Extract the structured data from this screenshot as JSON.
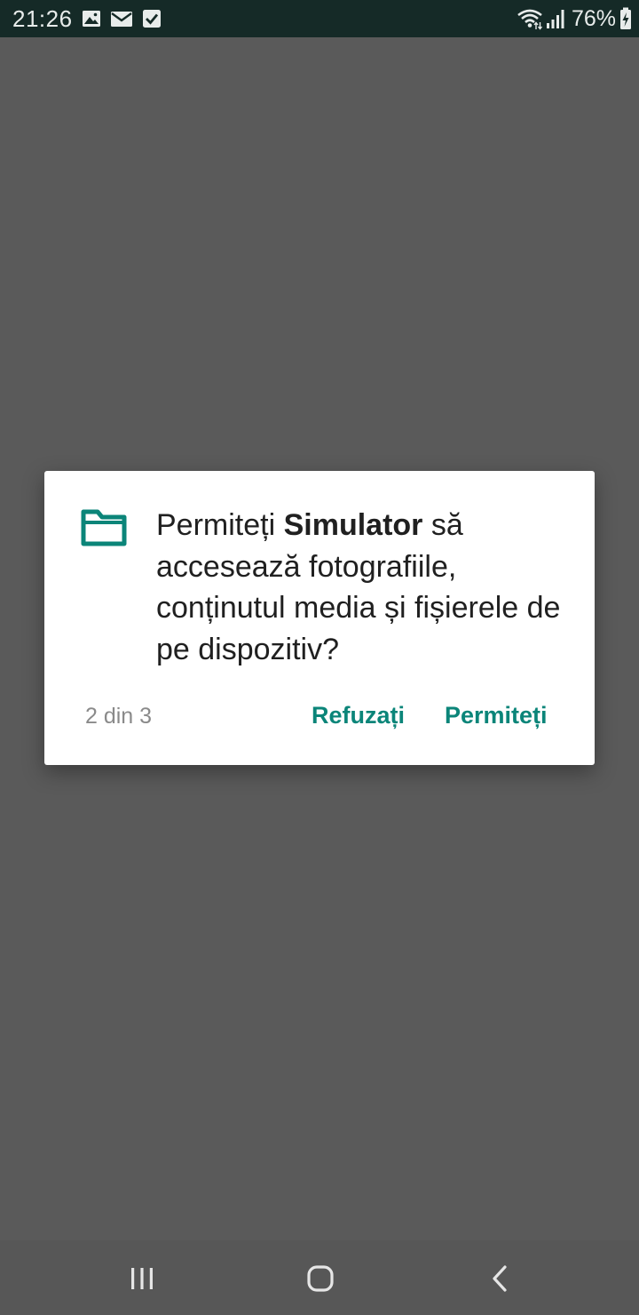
{
  "status_bar": {
    "time": "21:26",
    "left_icons": [
      "image-icon",
      "email-icon",
      "checkbox-icon"
    ],
    "right_icons": [
      "wifi-icon",
      "signal-icon",
      "battery-charging-icon"
    ],
    "battery_percent": "76%"
  },
  "dialog": {
    "icon": "folder-icon",
    "message_prefix": "Permiteți ",
    "app_name": "Simulator",
    "message_suffix": " să accesează fotografiile, conținutul media și fișierele de pe dispozitiv?",
    "page_counter": "2 din 3",
    "deny_label": "Refuzați",
    "allow_label": "Permiteți",
    "accent_color": "#0b8579"
  },
  "nav_bar": {
    "buttons": [
      "recent-apps-icon",
      "home-icon",
      "back-icon"
    ]
  }
}
